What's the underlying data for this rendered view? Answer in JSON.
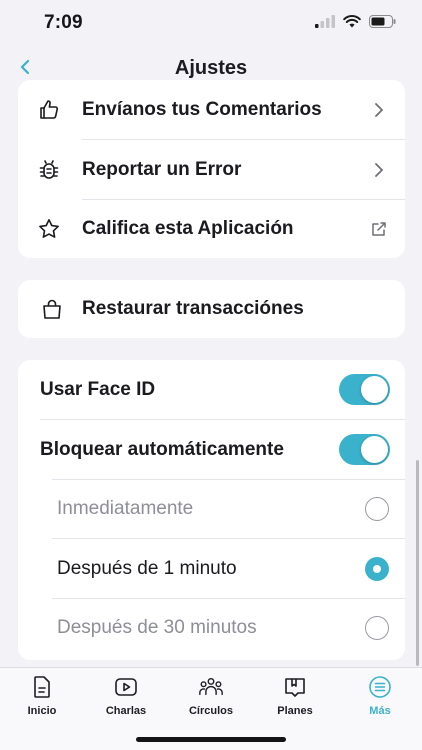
{
  "status": {
    "time": "7:09"
  },
  "nav": {
    "title": "Ajustes"
  },
  "feedback_card": {
    "items": [
      {
        "label": "Envíanos tus Comentarios",
        "icon": "thumbs-up-icon",
        "trail": "chevron-right-icon"
      },
      {
        "label": "Reportar un Error",
        "icon": "bug-icon",
        "trail": "chevron-right-icon"
      },
      {
        "label": "Califica esta Aplicación",
        "icon": "star-icon",
        "trail": "external-link-icon"
      }
    ]
  },
  "restore_card": {
    "label": "Restaurar transacciónes",
    "icon": "shopping-bag-icon"
  },
  "security_card": {
    "face_id": {
      "label": "Usar Face ID",
      "on": true
    },
    "auto_lock": {
      "label": "Bloquear automáticamente",
      "on": true
    },
    "options": [
      {
        "label": "Inmediatamente",
        "selected": false
      },
      {
        "label": "Después de 1 minuto",
        "selected": true
      },
      {
        "label": "Después de 30 minutos",
        "selected": false
      }
    ]
  },
  "tabs": [
    {
      "label": "Inicio",
      "icon": "document-icon",
      "active": false
    },
    {
      "label": "Charlas",
      "icon": "play-icon",
      "active": false
    },
    {
      "label": "Círculos",
      "icon": "people-icon",
      "active": false
    },
    {
      "label": "Planes",
      "icon": "book-icon",
      "active": false
    },
    {
      "label": "Más",
      "icon": "menu-icon",
      "active": true
    }
  ],
  "colors": {
    "accent": "#3bb2cc",
    "background": "#f2f2f7",
    "muted_text": "#8e8e98"
  }
}
